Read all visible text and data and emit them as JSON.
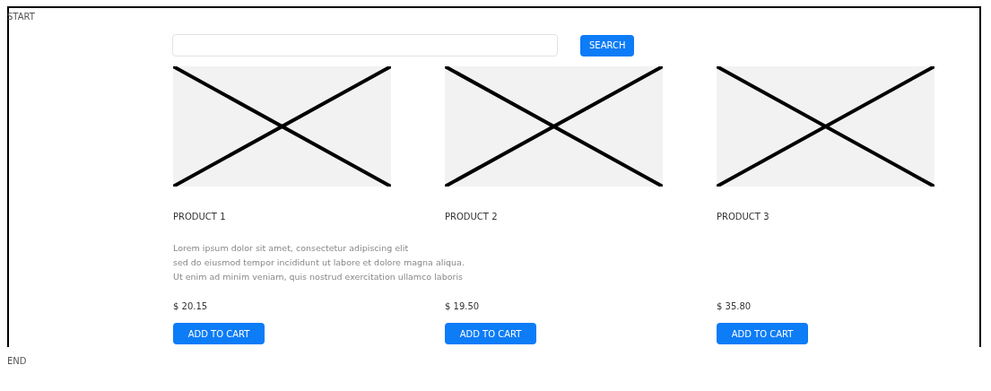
{
  "start_label": "START",
  "search": {
    "button": "SEARCH"
  },
  "products": [
    {
      "name": "PRODUCT 1",
      "description": [
        "Lorem ipsum dolor sit amet, consectetur adipiscing elit",
        "sed do eiusmod tempor incididunt ut labore et dolore magna aliqua.",
        "Ut enim ad minim veniam, quis nostrud exercitation ullamco laboris"
      ],
      "price": "$ 20.15",
      "button": "ADD TO CART"
    },
    {
      "name": "PRODUCT 2",
      "price": "$ 19.50",
      "button": "ADD TO CART"
    },
    {
      "name": "PRODUCT 3",
      "price": "$ 35.80",
      "button": "ADD TO CART"
    }
  ],
  "end_label": "END"
}
